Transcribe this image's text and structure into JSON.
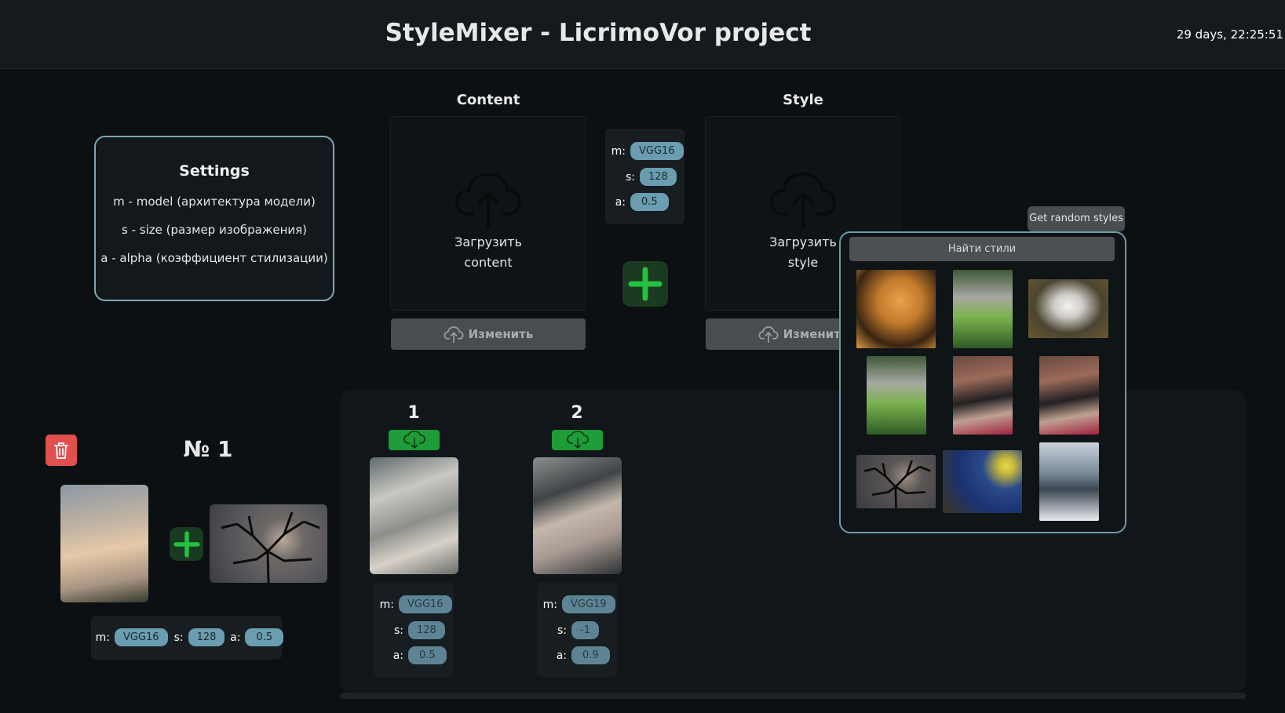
{
  "header": {
    "title": "StyleMixer - LicrimoVor project",
    "timer": "29 days, 22:25:51"
  },
  "settings": {
    "title": "Settings",
    "lines": [
      "m - model (архитектура модели)",
      "s - size (размер изображения)",
      "a - alpha (коэффициент стилизации)"
    ]
  },
  "content": {
    "heading": "Content",
    "upload_line1": "Загрузить",
    "upload_line2": "content",
    "change_label": "Изменить"
  },
  "style": {
    "heading": "Style",
    "upload_line1": "Загрузить",
    "upload_line2": "style",
    "change_label": "Изменить"
  },
  "params": {
    "m_label": "m:",
    "m_value": "VGG16",
    "s_label": "s:",
    "s_value": "128",
    "a_label": "a:",
    "a_value": "0.5"
  },
  "styles_popover": {
    "random_button": "Get random styles",
    "find_button": "Найти стили",
    "thumbnails": [
      "bee-cartoon",
      "zebra-grass",
      "white-horse",
      "zebra-grass",
      "cat-doorway",
      "cat-doorway",
      "tree-branches-moon",
      "starry-night",
      "snowy-street"
    ]
  },
  "entry": {
    "title": "№ 1",
    "m_label": "m:",
    "m_value": "VGG16",
    "s_label": "s:",
    "s_value": "128",
    "a_label": "a:",
    "a_value": "0.5"
  },
  "results": [
    {
      "num": "1",
      "m_label": "m:",
      "m_value": "VGG16",
      "s_label": "s:",
      "s_value": "128",
      "a_label": "a:",
      "a_value": "0.5"
    },
    {
      "num": "2",
      "m_label": "m:",
      "m_value": "VGG19",
      "s_label": "s:",
      "s_value": "-1",
      "a_label": "a:",
      "a_value": "0.9"
    }
  ],
  "colors": {
    "accent_chip": "#6a9db0",
    "download_green": "#1e9c38",
    "delete_red": "#e05050",
    "plus_green": "#23c23f"
  }
}
